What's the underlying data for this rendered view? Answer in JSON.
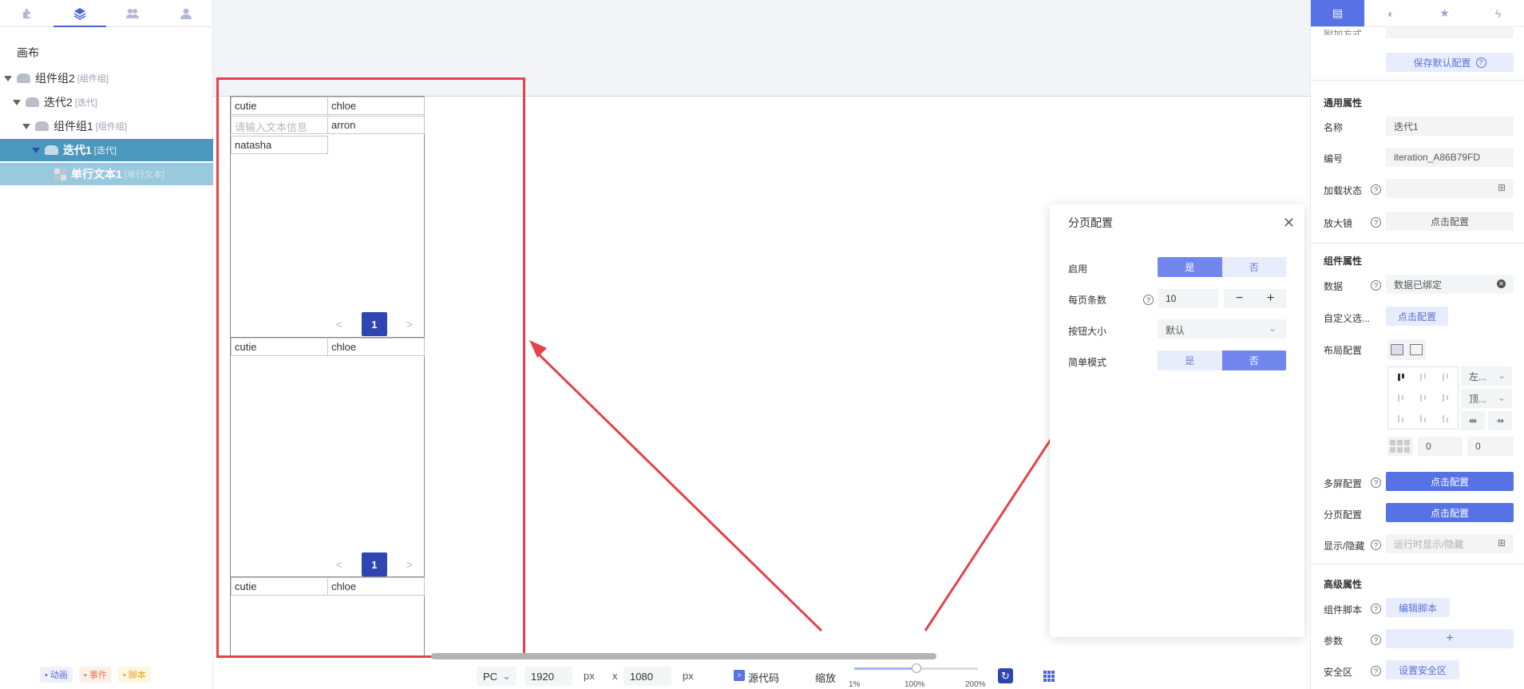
{
  "left_panel": {
    "canvas_label": "画布",
    "tree": [
      {
        "label": "组件组2",
        "tag": "[组件组]"
      },
      {
        "label": "迭代2",
        "tag": "[迭代]"
      },
      {
        "label": "组件组1",
        "tag": "[组件组]"
      },
      {
        "label": "迭代1",
        "tag": "[迭代]"
      },
      {
        "label": "单行文本1",
        "tag": "[单行文本]"
      }
    ],
    "bottom_tags": {
      "animation": "• 动画",
      "event": "• 事件",
      "script": "• 脚本"
    }
  },
  "canvas": {
    "blocks": [
      {
        "cells": [
          "cutie",
          "chloe",
          "请输入文本信息",
          "arron",
          "natasha"
        ],
        "page": "1"
      },
      {
        "cells": [
          "cutie",
          "chloe"
        ],
        "page": "1"
      },
      {
        "cells": [
          "cutie",
          "chloe"
        ]
      }
    ],
    "prev_arrow": "<",
    "next_arrow": ">"
  },
  "popup": {
    "title": "分页配置",
    "enable_label": "启用",
    "yes": "是",
    "no": "否",
    "per_page_label": "每页条数",
    "per_page_value": "10",
    "minus": "−",
    "plus": "+",
    "button_size_label": "按钮大小",
    "button_size_value": "默认",
    "simple_mode_label": "简单模式",
    "enable_selected": "是",
    "simple_selected": "否"
  },
  "toolbar": {
    "device": "PC",
    "width": "1920",
    "height": "1080",
    "unit": "px",
    "times": "x",
    "source_code": "源代码",
    "zoom_label": "缩放",
    "zoom_min": "1%",
    "zoom_mid": "100%",
    "zoom_max": "200%",
    "zoom_fraction": 0.5
  },
  "right_panel": {
    "save_default": "保存默认配置",
    "general_section": "通用属性",
    "name_label": "名称",
    "name_value": "迭代1",
    "id_label": "编号",
    "id_value": "iteration_A86B79FD",
    "load_state_label": "加载状态",
    "magnifier_label": "放大镜",
    "click_config": "点击配置",
    "component_section": "组件属性",
    "data_label": "数据",
    "data_value": "数据已绑定",
    "custom_label": "自定义选...",
    "layout_label": "布局配置",
    "layout_h": "左...",
    "layout_v": "顶...",
    "gap_1": "0",
    "gap_2": "0",
    "multiscreen_label": "多屏配置",
    "pagination_label": "分页配置",
    "show_hide_label": "显示/隐藏",
    "show_hide_placeholder": "运行时显示/隐藏",
    "advanced_section": "高级属性",
    "script_label": "组件脚本",
    "edit_script": "编辑脚本",
    "params_label": "参数",
    "params_add": "+",
    "safe_area_label": "安全区",
    "set_safe_area": "设置安全区",
    "top_cut_label": "附加方式"
  },
  "colors": {
    "accent": "#5772e5",
    "selection": "#4a98bd",
    "annotation": "#e5424d",
    "pager": "#2f45b2"
  }
}
